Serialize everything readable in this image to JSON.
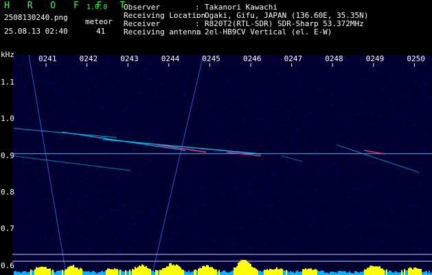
{
  "app": {
    "name": "H R O F F T",
    "version": "1.0.0"
  },
  "file": {
    "filename": "2508130240.png",
    "datetime": "25.08.13 02:40",
    "meteor_label": "meteor",
    "meteor_count": "41"
  },
  "info": [
    {
      "label": "Observer",
      "value": "Takanori Kawachi"
    },
    {
      "label": "Receiving Location",
      "value": "Ogaki, Gifu, JAPAN (136.60E, 35.35N)"
    },
    {
      "label": "Receiver",
      "value": "R820T2(RTL-SDR) SDR-Sharp 53.372MHz"
    },
    {
      "label": "Receiving antenna",
      "value": "2el-HB9CV Vertical (el. E-W)"
    }
  ],
  "chart_data": {
    "type": "heatmap",
    "ylabel": "kHz",
    "x_ticks": [
      "0241",
      "0242",
      "0243",
      "0244",
      "0245",
      "0246",
      "0247",
      "0248",
      "0249",
      "0250"
    ],
    "y_ticks": [
      "1.1",
      "1.0",
      "0.9",
      "0.8",
      "0.7",
      "0.6"
    ],
    "ylim": [
      0.575,
      1.175
    ],
    "carrier_khz": 0.906,
    "colors": {
      "background": "#000030",
      "noise": "#0000b4",
      "trace": "#00c8ff",
      "hot": "#ff3c8c",
      "signal_bar": "#ffff00",
      "noise_bar": "#00b4ff"
    }
  }
}
